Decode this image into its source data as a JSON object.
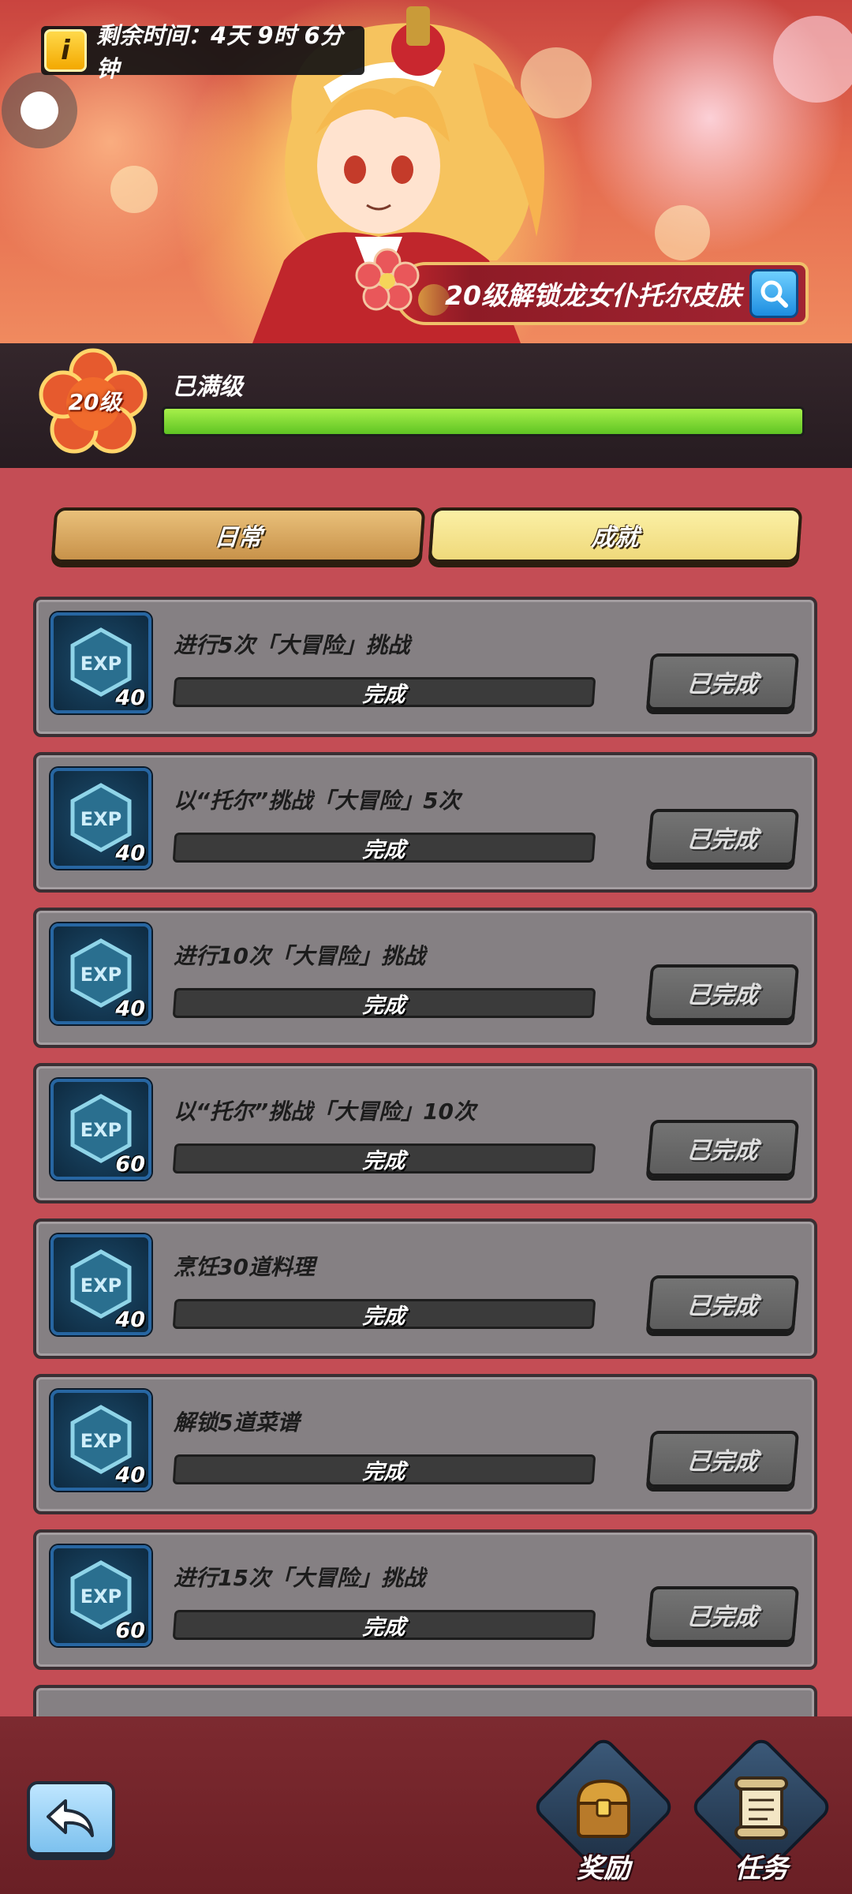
{
  "timer": {
    "icon": "info-icon",
    "icon_text": "i",
    "text": "剩余时间：4天 9时 6分钟"
  },
  "banner": {
    "unlock_text": "20级解锁龙女仆托尔皮肤",
    "search_icon": "magnifier-icon"
  },
  "level": {
    "badge": "20级",
    "status": "已满级",
    "progress": 1.0
  },
  "tabs": [
    {
      "label": "日常"
    },
    {
      "label": "成就"
    }
  ],
  "tasks": [
    {
      "title": "进行5次「大冒险」挑战",
      "exp": "40",
      "progress_label": "完成",
      "button": "已完成"
    },
    {
      "title": "以“托尔”挑战「大冒险」5次",
      "exp": "40",
      "progress_label": "完成",
      "button": "已完成"
    },
    {
      "title": "进行10次「大冒险」挑战",
      "exp": "40",
      "progress_label": "完成",
      "button": "已完成"
    },
    {
      "title": "以“托尔”挑战「大冒险」10次",
      "exp": "60",
      "progress_label": "完成",
      "button": "已完成"
    },
    {
      "title": "烹饪30道料理",
      "exp": "40",
      "progress_label": "完成",
      "button": "已完成"
    },
    {
      "title": "解锁5道菜谱",
      "exp": "40",
      "progress_label": "完成",
      "button": "已完成"
    },
    {
      "title": "进行15次「大冒险」挑战",
      "exp": "60",
      "progress_label": "完成",
      "button": "已完成"
    }
  ],
  "exp_icon_text": "EXP",
  "bottom_nav": [
    {
      "label": "奖励",
      "icon": "treasure-chest-icon"
    },
    {
      "label": "任务",
      "icon": "scroll-icon"
    }
  ],
  "colors": {
    "accent_green": "#6fd02f",
    "panel_red": "#c44d55",
    "card_gray": "#858083"
  }
}
